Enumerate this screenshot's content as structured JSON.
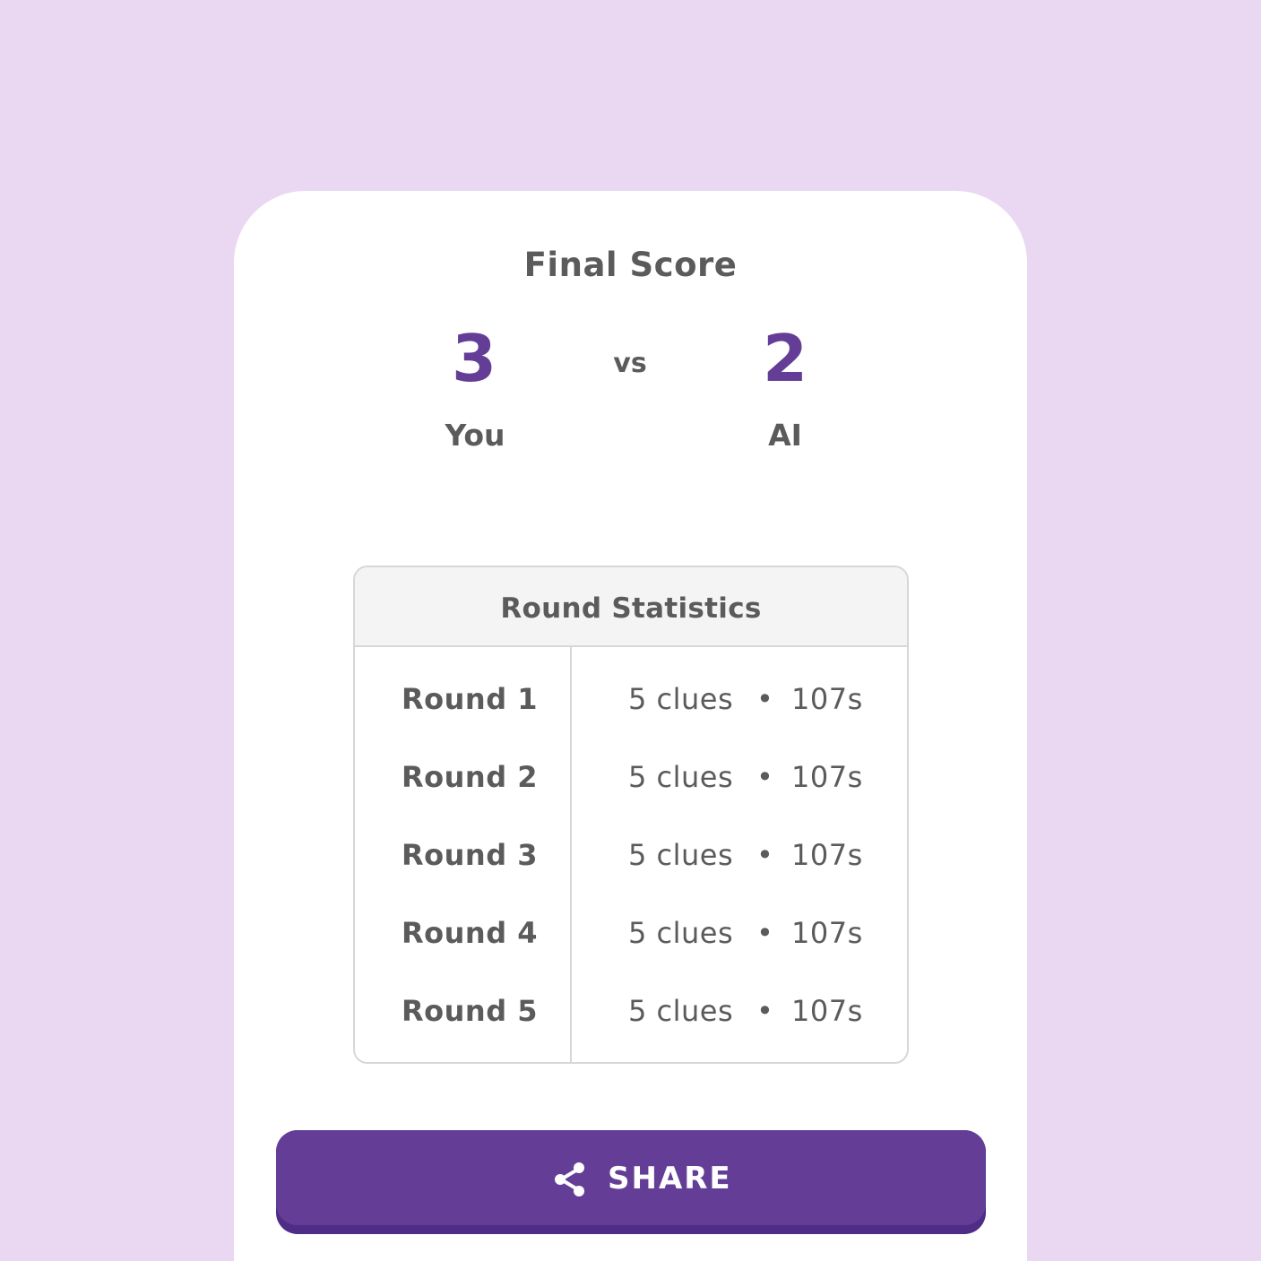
{
  "colors": {
    "background": "#EAD8F2",
    "card": "#FFFFFF",
    "accent": "#643E96",
    "text": "#5B5B5B",
    "border": "#D7D7D7"
  },
  "final_score": {
    "title": "Final Score",
    "player_score": "3",
    "player_label": "You",
    "vs_label": "vs",
    "ai_score": "2",
    "ai_label": "AI"
  },
  "round_statistics": {
    "title": "Round Statistics",
    "rows": [
      {
        "round": "Round 1",
        "clues": "5 clues",
        "separator": "•",
        "time": "107s"
      },
      {
        "round": "Round 2",
        "clues": "5 clues",
        "separator": "•",
        "time": "107s"
      },
      {
        "round": "Round 3",
        "clues": "5 clues",
        "separator": "•",
        "time": "107s"
      },
      {
        "round": "Round 4",
        "clues": "5 clues",
        "separator": "•",
        "time": "107s"
      },
      {
        "round": "Round 5",
        "clues": "5 clues",
        "separator": "•",
        "time": "107s"
      }
    ]
  },
  "share": {
    "label": "SHARE",
    "icon": "share-icon"
  }
}
